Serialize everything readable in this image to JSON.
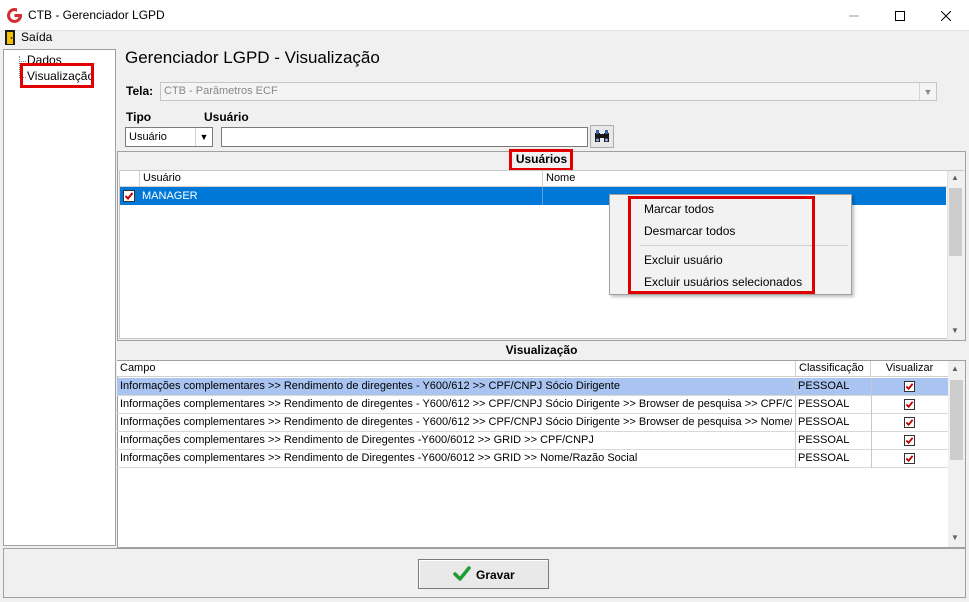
{
  "window": {
    "title": "CTB - Gerenciador LGPD"
  },
  "menu": {
    "exit_label": "Saída"
  },
  "tree": {
    "items": [
      "Dados",
      "Visualização"
    ]
  },
  "header": {
    "page_title": "Gerenciador LGPD - Visualização",
    "tela_label": "Tela:",
    "tela_value": "CTB - Parâmetros ECF",
    "tipo_label": "Tipo",
    "usuario_label": "Usuário",
    "tipo_value": "Usuário",
    "usuario_value": ""
  },
  "users": {
    "title": "Usuários",
    "columns": [
      "Usuário",
      "Nome"
    ],
    "rows": [
      {
        "user": "MANAGER",
        "name": "",
        "checked": true
      }
    ]
  },
  "context_menu": {
    "items": [
      "Marcar todos",
      "Desmarcar todos",
      "Excluir usuário",
      "Excluir usuários selecionados"
    ]
  },
  "visualizacao": {
    "title": "Visualização",
    "columns": [
      "Campo",
      "Classificação",
      "Visualizar"
    ],
    "rows": [
      {
        "campo": "Informações complementares >> Rendimento de diregentes - Y600/612 >> CPF/CNPJ Sócio Dirigente",
        "classificacao": "PESSOAL",
        "visualizar": true
      },
      {
        "campo": "Informações complementares >> Rendimento de diregentes - Y600/612 >> CPF/CNPJ Sócio Dirigente >> Browser de pesquisa >> CPF/CNPJ",
        "classificacao": "PESSOAL",
        "visualizar": true
      },
      {
        "campo": "Informações complementares >> Rendimento de diregentes - Y600/612 >> CPF/CNPJ Sócio Dirigente >> Browser de pesquisa >> Nome/Ra...",
        "classificacao": "PESSOAL",
        "visualizar": true
      },
      {
        "campo": "Informações complementares >> Rendimento de Diregentes -Y600/6012 >> GRID >> CPF/CNPJ",
        "classificacao": "PESSOAL",
        "visualizar": true
      },
      {
        "campo": "Informações complementares >> Rendimento de Diregentes -Y600/6012 >> GRID >> Nome/Razão Social",
        "classificacao": "PESSOAL",
        "visualizar": true
      }
    ]
  },
  "footer": {
    "save_label": "Gravar"
  },
  "colors": {
    "selection": "#0078d7",
    "highlight_box": "#e00000",
    "row_selected": "#a9c4f0",
    "check": "#c00000",
    "brand": "#d32f2f"
  },
  "icons": [
    "app-logo-icon",
    "exit-door-icon",
    "binoculars-search-icon",
    "checkmark-icon"
  ]
}
